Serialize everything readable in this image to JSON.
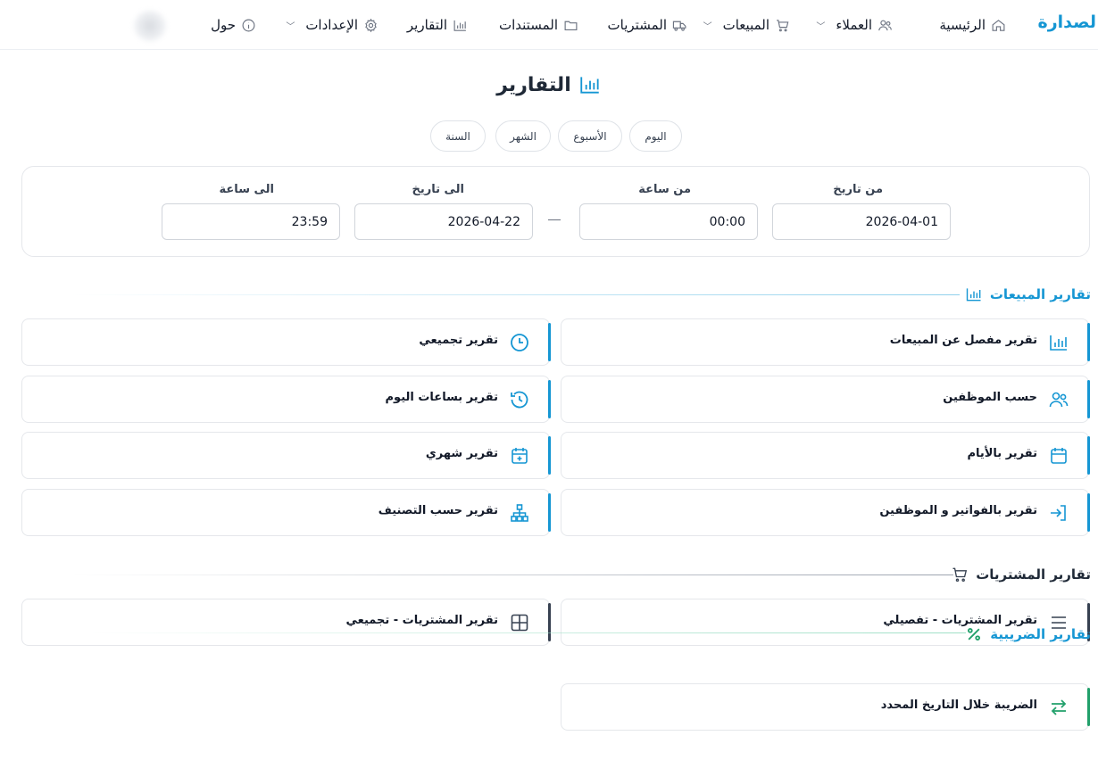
{
  "nav": {
    "brand": "لصدارة",
    "items": [
      {
        "label": "الرئيسية"
      },
      {
        "label": "العملاء"
      },
      {
        "label": "المبيعات"
      },
      {
        "label": "المشتريات"
      },
      {
        "label": "المستندات"
      },
      {
        "label": "التقارير"
      },
      {
        "label": "الإعدادات"
      },
      {
        "label": "حول"
      }
    ]
  },
  "page": {
    "title": "التقارير"
  },
  "periods": [
    "اليوم",
    "الأسبوع",
    "الشهر",
    "السنة"
  ],
  "filters": {
    "from_date_label": "من تاريخ",
    "from_date_value": "2026-04-01",
    "from_time_label": "من ساعة",
    "from_time_value": "00:00",
    "to_date_label": "الى تاريخ",
    "to_date_value": "2026-04-22",
    "to_time_label": "الى ساعة",
    "to_time_value": "23:59"
  },
  "sections": {
    "sales": {
      "title": "تقارير المبيعات",
      "accent_color": "#1596d3",
      "cards": [
        {
          "label": "تقرير مفصل عن المبيعات",
          "icon": "bar-chart-icon"
        },
        {
          "label": "تقرير تجميعي",
          "icon": "clock-icon"
        },
        {
          "label": "حسب الموظفين",
          "icon": "users-icon"
        },
        {
          "label": "تقرير بساعات اليوم",
          "icon": "history-icon"
        },
        {
          "label": "تقرير بالأيام",
          "icon": "calendar-icon"
        },
        {
          "label": "تقرير شهري",
          "icon": "calendar-plus-icon"
        },
        {
          "label": "تقرير بالفواتير و الموظفين",
          "icon": "sign-in-icon"
        },
        {
          "label": "تقرير حسب التصنيف",
          "icon": "sitemap-icon"
        }
      ]
    },
    "purchases": {
      "title": "تقارير المشتريات",
      "accent_color": "#374151",
      "cards": [
        {
          "label": "تقرير المشتريات - تفصيلي",
          "icon": "list-icon"
        },
        {
          "label": "تقرير المشتريات - تجميعي",
          "icon": "grid-icon"
        }
      ]
    },
    "tax": {
      "title": "تقارير الضريبية",
      "accent_color": "#1596d3",
      "cards": [
        {
          "label": "الضريبة خلال التاريخ المحدد",
          "icon": "exchange-icon"
        }
      ]
    }
  },
  "colors": {
    "brand": "#1596d3",
    "tax_icon": "#22a06b",
    "border": "#e5e7eb"
  }
}
